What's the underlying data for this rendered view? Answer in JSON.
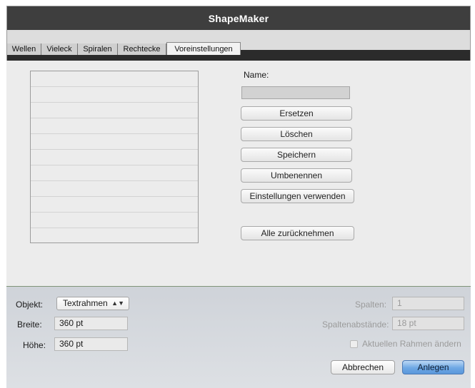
{
  "window": {
    "title": "ShapeMaker"
  },
  "tabs": [
    "Wellen",
    "Vieleck",
    "Spiralen",
    "Rechtecke",
    "Voreinstellungen"
  ],
  "presets": {
    "name_label": "Name:",
    "name_value": "",
    "list_items": [],
    "buttons": {
      "replace": "Ersetzen",
      "delete": "Löschen",
      "save": "Speichern",
      "rename": "Umbenennen",
      "use_settings": "Einstellungen verwenden",
      "reset_all": "Alle zurücknehmen"
    }
  },
  "bottom": {
    "object_label": "Objekt:",
    "object_value": "Textrahmen",
    "width_label": "Breite:",
    "width_value": "360 pt",
    "height_label": "Höhe:",
    "height_value": "360 pt",
    "columns_label": "Spalten:",
    "columns_value": "1",
    "gutter_label": "Spaltenabstände:",
    "gutter_value": "18 pt",
    "modify_frame_label": "Aktuellen Rahmen ändern",
    "modify_frame_checked": false
  },
  "dialog_buttons": {
    "cancel": "Abbrechen",
    "ok": "Anlegen"
  },
  "colors": {
    "titlebar": "#3e3e3e",
    "primary_button": "#6da7e4",
    "tabbar": "#2b2b2b"
  }
}
